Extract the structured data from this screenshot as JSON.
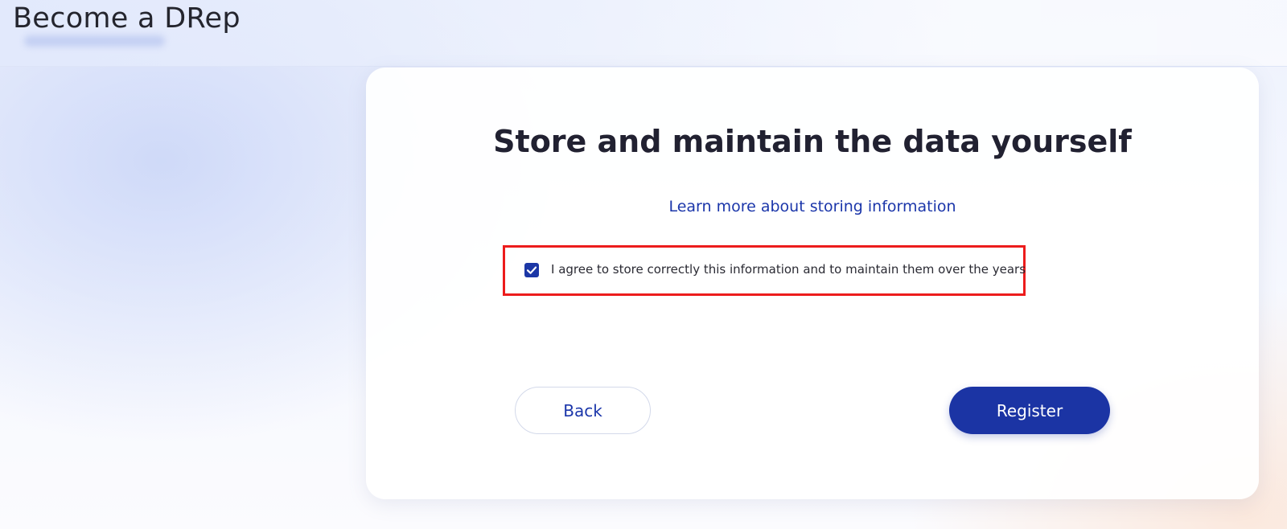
{
  "header": {
    "title": "Become a DRep"
  },
  "card": {
    "heading": "Store and maintain the data yourself",
    "learn_more_link": "Learn more about storing information",
    "agreement": {
      "checked": true,
      "label": "I agree to store correctly this information and to maintain them over the years",
      "highlight_color": "#ec1c1c"
    },
    "buttons": {
      "back_label": "Back",
      "register_label": "Register"
    }
  },
  "colors": {
    "primary": "#1b34a4",
    "link": "#1b36aa",
    "heading": "#212131"
  },
  "icons": {
    "checkbox_mark": "checkmark-icon"
  }
}
